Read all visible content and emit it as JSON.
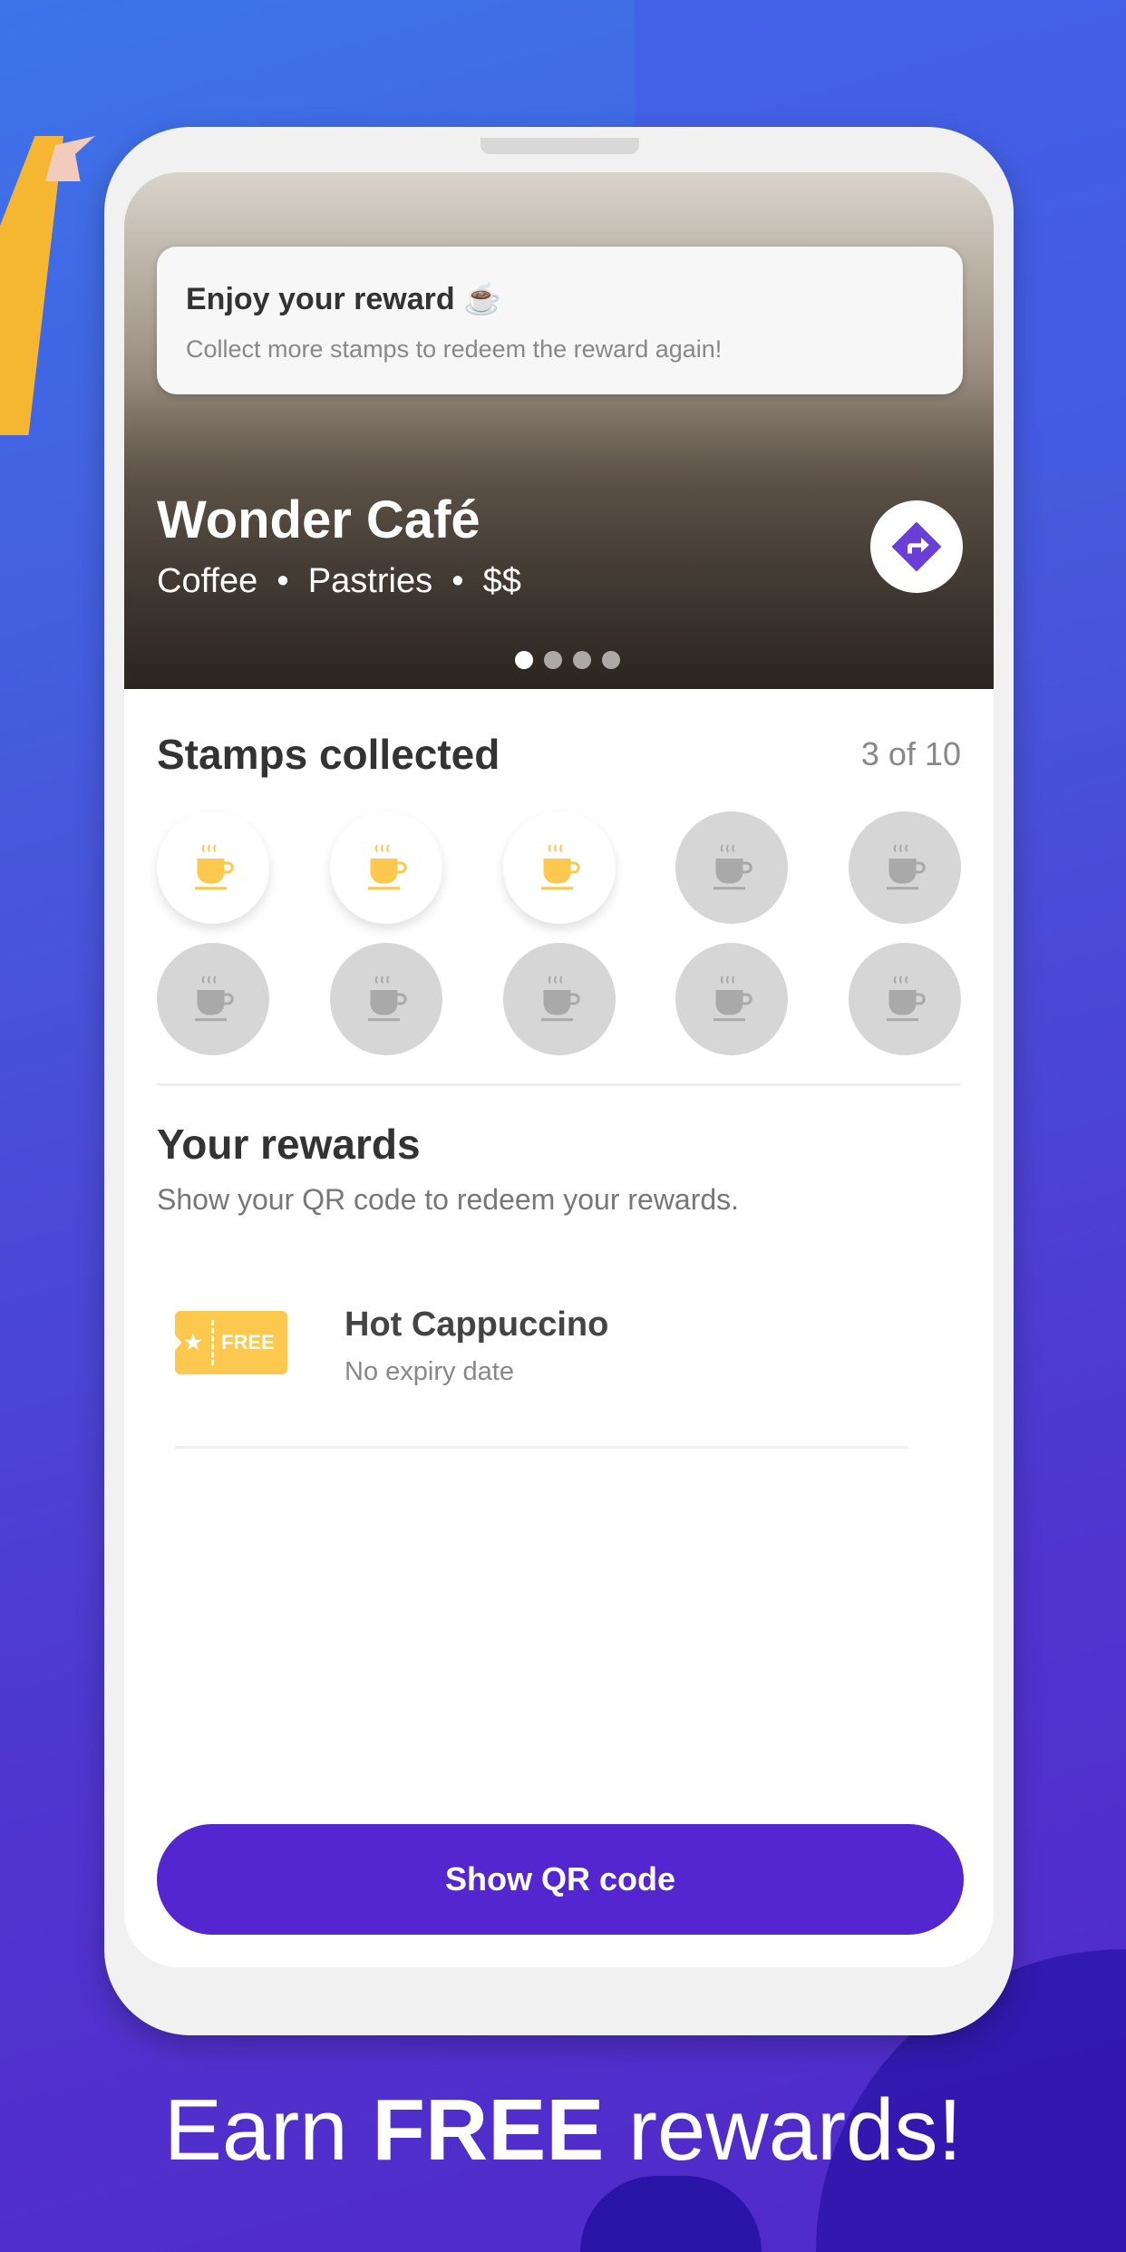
{
  "toast": {
    "title": "Enjoy your reward ☕",
    "message": "Collect more stamps to redeem the reward again!"
  },
  "cafe": {
    "name": "Wonder Café",
    "tags": "Coffee  •  Pastries  •  $$",
    "share_icon": "directions-icon"
  },
  "carousel": {
    "total": 4,
    "active": 1
  },
  "stamps": {
    "title": "Stamps collected",
    "count_label": "3 of 10",
    "collected": 3,
    "total": 10,
    "collected_color": "#fcc94e",
    "empty_color": "#a9a9a9"
  },
  "rewards": {
    "title": "Your rewards",
    "subtitle": "Show your QR code to redeem your rewards.",
    "items": [
      {
        "badge": "FREE",
        "name": "Hot Cappuccino",
        "expiry": "No expiry date"
      }
    ]
  },
  "actions": {
    "show_qr": "Show QR code"
  },
  "tagline": {
    "normal": "Earn ",
    "bold": "FREE",
    "rest": " rewards!"
  },
  "colors": {
    "accent": "#5426d0",
    "ticket": "#fcc94e"
  }
}
